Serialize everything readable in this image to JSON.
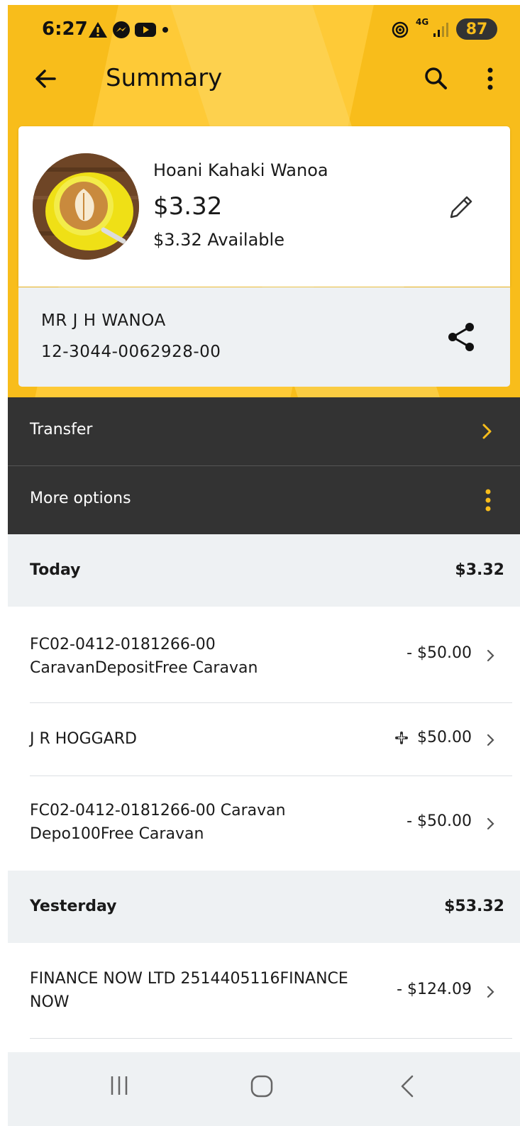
{
  "status_bar": {
    "time": "6:27",
    "battery": "87",
    "network": "4G"
  },
  "appbar": {
    "title": "Summary",
    "back_icon": "arrow-left-icon",
    "search_icon": "search-icon",
    "menu_icon": "more-vert-icon"
  },
  "account": {
    "name": "Hoani Kahaki Wanoa",
    "balance": "$3.32",
    "available": "$3.32 Available",
    "holder": "MR J H WANOA",
    "number": "12-3044-0062928-00"
  },
  "actions": {
    "transfer_label": "Transfer",
    "more_options_label": "More options"
  },
  "groups": [
    {
      "label": "Today",
      "total": "$3.32",
      "transactions": [
        {
          "line1": "FC02-0412-0181266-00",
          "line2": "CaravanDepositFree Caravan",
          "amount": "- $50.00"
        },
        {
          "line1": "J R HOGGARD",
          "line2": "",
          "amount": "$50.00"
        },
        {
          "line1": "FC02-0412-0181266-00 Caravan",
          "line2": "Depo100Free Caravan",
          "amount": "- $50.00"
        }
      ]
    },
    {
      "label": "Yesterday",
      "total": "$53.32",
      "transactions": [
        {
          "line1": "FINANCE NOW LTD 2514405116FINANCE",
          "line2": "NOW",
          "amount": "- $124.09"
        }
      ]
    }
  ],
  "colors": {
    "brand_yellow": "#f8bd1b",
    "dark_panel": "#333333",
    "light_panel": "#eef1f3"
  }
}
